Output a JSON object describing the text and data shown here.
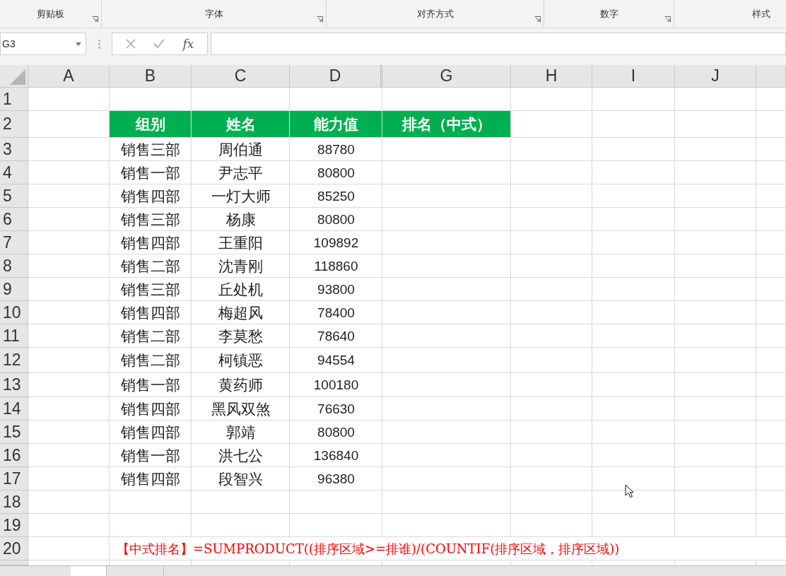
{
  "ribbon": {
    "groups": [
      {
        "label": "剪贴板",
        "launcher": true
      },
      {
        "label": "字体",
        "launcher": true
      },
      {
        "label": "对齐方式",
        "launcher": true
      },
      {
        "label": "数字",
        "launcher": true
      },
      {
        "label": "样式",
        "launcher": false
      }
    ]
  },
  "formula_bar": {
    "name_box": "G3",
    "fx": "fx"
  },
  "sheet": {
    "columns": [
      "A",
      "B",
      "C",
      "D",
      "G",
      "H",
      "I",
      "J"
    ],
    "row_numbers": [
      "1",
      "2",
      "3",
      "4",
      "5",
      "6",
      "7",
      "8",
      "9",
      "10",
      "11",
      "12",
      "13",
      "14",
      "15",
      "16",
      "17",
      "18",
      "19",
      "20"
    ],
    "table": {
      "columns": [
        "组别",
        "姓名",
        "能力值",
        "排名（中式）"
      ],
      "rows": [
        [
          "销售三部",
          "周伯通",
          "88780"
        ],
        [
          "销售一部",
          "尹志平",
          "80800"
        ],
        [
          "销售四部",
          "一灯大师",
          "85250"
        ],
        [
          "销售三部",
          "杨康",
          "80800"
        ],
        [
          "销售四部",
          "王重阳",
          "109892"
        ],
        [
          "销售二部",
          "沈青刚",
          "118860"
        ],
        [
          "销售三部",
          "丘处机",
          "93800"
        ],
        [
          "销售四部",
          "梅超风",
          "78400"
        ],
        [
          "销售二部",
          "李莫愁",
          "78640"
        ],
        [
          "销售二部",
          "柯镇恶",
          "94554"
        ],
        [
          "销售一部",
          "黄药师",
          "100180"
        ],
        [
          "销售四部",
          "黑风双煞",
          "76630"
        ],
        [
          "销售四部",
          "郭靖",
          "80800"
        ],
        [
          "销售一部",
          "洪七公",
          "136840"
        ],
        [
          "销售四部",
          "段智兴",
          "96380"
        ]
      ]
    },
    "note": "【中式排名】=SUMPRODUCT((排序区域>=排谁)/(COUNTIF(排序区域，排序区域))"
  }
}
